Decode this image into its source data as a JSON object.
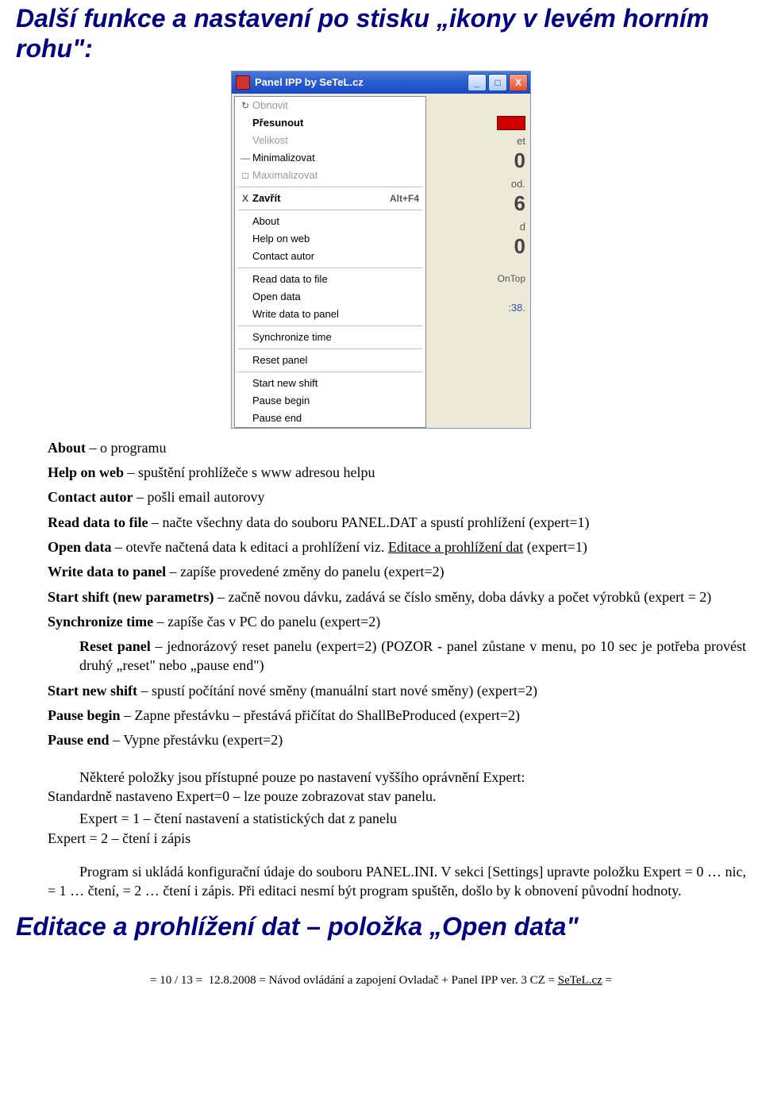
{
  "heading1": "Další funkce a nastavení po stisku „ikony v levém horním rohu\":",
  "window": {
    "title": "Panel IPP by SeTeL.cz",
    "buttons": {
      "min": "_",
      "max": "□",
      "close": "X"
    },
    "menu": [
      {
        "type": "item",
        "label": "Obnovit",
        "icon": "↻",
        "disabled": true
      },
      {
        "type": "item",
        "label": "Přesunout",
        "bold": true
      },
      {
        "type": "item",
        "label": "Velikost",
        "disabled": true
      },
      {
        "type": "item",
        "label": "Minimalizovat",
        "icon": "—"
      },
      {
        "type": "item",
        "label": "Maximalizovat",
        "icon": "□",
        "disabled": true
      },
      {
        "type": "sep"
      },
      {
        "type": "item",
        "label": "Zavřít",
        "icon": "X",
        "bold": true,
        "shortcut": "Alt+F4"
      },
      {
        "type": "sep"
      },
      {
        "type": "item",
        "label": "About"
      },
      {
        "type": "item",
        "label": "Help on web"
      },
      {
        "type": "item",
        "label": "Contact autor"
      },
      {
        "type": "sep"
      },
      {
        "type": "item",
        "label": "Read data to file"
      },
      {
        "type": "item",
        "label": "Open data"
      },
      {
        "type": "item",
        "label": "Write data to panel"
      },
      {
        "type": "sep"
      },
      {
        "type": "item",
        "label": "Synchronize time"
      },
      {
        "type": "sep"
      },
      {
        "type": "item",
        "label": "Reset panel"
      },
      {
        "type": "sep"
      },
      {
        "type": "item",
        "label": "Start new shift"
      },
      {
        "type": "item",
        "label": "Pause begin"
      },
      {
        "type": "item",
        "label": "Pause end"
      }
    ],
    "right": {
      "l1": "et",
      "v1": "0",
      "l2": "od.",
      "v2": "6",
      "l3": "d",
      "v3": "0",
      "ontop": "OnTop",
      "time": ":38."
    }
  },
  "defs": [
    {
      "b": "About",
      "t": " – o programu"
    },
    {
      "b": "Help on web",
      "t": " – spuštění prohlížeče s www adresou helpu"
    },
    {
      "b": "Contact autor",
      "t": " – pošli email autorovy"
    },
    {
      "b": "Read data to file",
      "t": " – načte všechny data do souboru PANEL.DAT a spustí prohlížení (expert=1)"
    },
    {
      "b": "Open data",
      "t": " – otevře načtená data k editaci a prohlížení viz. ",
      "u": "Editace a prohlížení dat",
      "after": " (expert=1)"
    },
    {
      "b": "Write data to panel",
      "t": " – zapíše provedené změny do panelu (expert=2)"
    },
    {
      "b": "Start shift (new parametrs)",
      "t": " – začně novou dávku, zadává se číslo směny, doba dávky a počet výrobků (expert = 2)"
    },
    {
      "b": "Synchronize time",
      "t": " – zapíše čas v PC do panelu (expert=2)"
    },
    {
      "b": "Reset panel",
      "t": " – jednorázový reset panelu (expert=2) (POZOR - panel zůstane v menu, po 10 sec je potřeba provést druhý „reset\" nebo „pause end\")",
      "noindent": true
    },
    {
      "b": "Start new shift",
      "t": " – spustí počítání nové směny (manuální start nové směny) (expert=2)"
    },
    {
      "b": "Pause begin",
      "t": " – Zapne přestávku – přestává přičítat do ShallBeProduced (expert=2)"
    },
    {
      "b": "Pause end",
      "t": " – Vypne přestávku (expert=2)"
    }
  ],
  "expertBlock": {
    "p1a": "Některé položky jsou přístupné pouze po nastavení vyššího oprávnění Expert:",
    "p1b": "Standardně nastaveno Expert=0 – lze pouze zobrazovat stav panelu.",
    "p2a": "Expert = 1 – čtení nastavení a statistických dat z panelu",
    "p2b": "Expert = 2 – čtení i zápis",
    "p3": "Program si ukládá konfigurační údaje do souboru PANEL.INI. V sekci [Settings] upravte položku Expert = 0 … nic, = 1 … čtení, = 2 … čtení i zápis. Při editaci nesmí být program spuštěn, došlo by k obnovení původní hodnoty."
  },
  "heading2": "Editace a prohlížení dat – položka „Open data\"",
  "footer": {
    "pageCur": "10",
    "pageTot": "13",
    "date": "12.8.2008",
    "mid": "Návod ovládání a zapojení Ovladač + Panel IPP ver. 3 CZ",
    "link": "SeTeL.cz"
  }
}
